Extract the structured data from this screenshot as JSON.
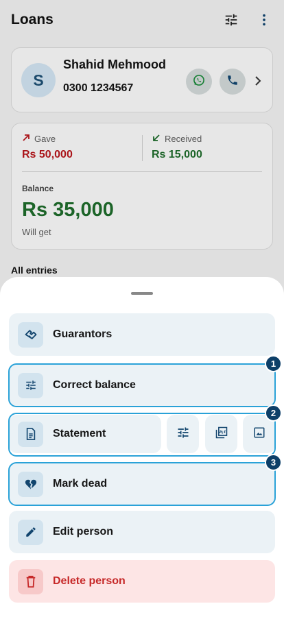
{
  "appbar": {
    "title": "Loans",
    "filter_icon": "tune-icon",
    "menu_icon": "more-vert-icon"
  },
  "person": {
    "avatar_letter": "S",
    "name": "Shahid Mehmood",
    "phone": "0300 1234567"
  },
  "summary": {
    "gave_label": "Gave",
    "gave_value": "Rs 50,000",
    "received_label": "Received",
    "received_value": "Rs 15,000",
    "balance_label": "Balance",
    "balance_value": "Rs 35,000",
    "balance_sub": "Will get"
  },
  "entries": {
    "heading": "All entries"
  },
  "sheet": {
    "items": {
      "guarantors": "Guarantors",
      "correct_balance": "Correct balance",
      "statement": "Statement",
      "mark_dead": "Mark dead",
      "edit_person": "Edit person",
      "delete_person": "Delete person"
    },
    "badges": [
      "1",
      "2",
      "3"
    ]
  },
  "colors": {
    "accent": "#2aa2d8",
    "badge": "#0d3f68",
    "danger": "#c62828",
    "positive": "#1e6b2b",
    "negative": "#b5161b"
  }
}
